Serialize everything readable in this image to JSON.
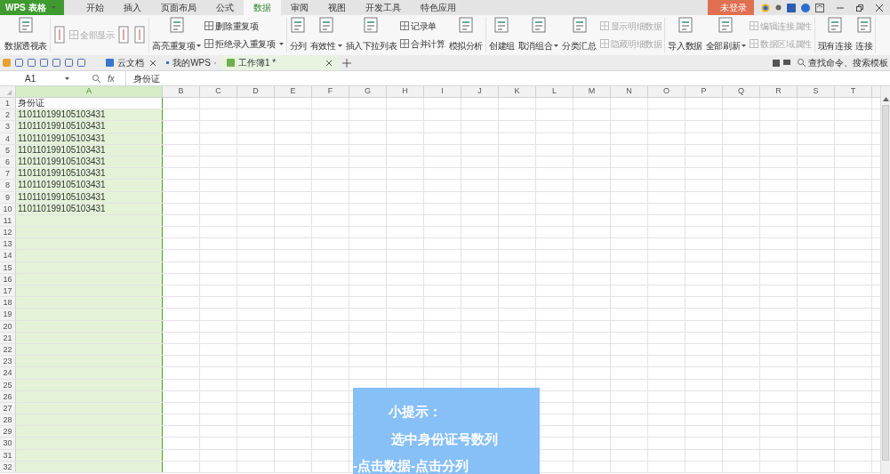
{
  "title_bar": {
    "app_button": "WPS 表格",
    "menu_tabs": [
      {
        "label": "开始",
        "selected": false
      },
      {
        "label": "插入",
        "selected": false
      },
      {
        "label": "页面布局",
        "selected": false
      },
      {
        "label": "公式",
        "selected": false
      },
      {
        "label": "数据",
        "selected": true
      },
      {
        "label": "审阅",
        "selected": false
      },
      {
        "label": "视图",
        "selected": false
      },
      {
        "label": "开发工具",
        "selected": false
      },
      {
        "label": "特色应用",
        "selected": false
      }
    ],
    "login": "未登录"
  },
  "ribbon": {
    "groups": [
      {
        "items": [
          {
            "kind": "large",
            "label": "数据透视表",
            "dropdown": false,
            "disabled": false
          }
        ]
      },
      {
        "items": [
          {
            "kind": "icon"
          },
          {
            "kind": "stack",
            "children": [
              {
                "label": "全部显示",
                "disabled": true,
                "dropdown": false
              }
            ]
          },
          {
            "kind": "icon"
          },
          {
            "kind": "icon"
          }
        ]
      },
      {
        "items": [
          {
            "kind": "large",
            "label": "高亮重复项",
            "dropdown": true,
            "disabled": false
          },
          {
            "kind": "stack",
            "children": [
              {
                "label": "删除重复项",
                "disabled": false,
                "dropdown": false
              },
              {
                "label": "拒绝录入重复项",
                "disabled": false,
                "dropdown": true
              }
            ]
          }
        ]
      },
      {
        "items": [
          {
            "kind": "large",
            "label": "分列",
            "dropdown": false,
            "disabled": false
          },
          {
            "kind": "large",
            "label": "有效性",
            "dropdown": true,
            "disabled": false
          },
          {
            "kind": "large",
            "label": "插入下拉列表",
            "dropdown": false,
            "disabled": false
          },
          {
            "kind": "stack",
            "children": [
              {
                "label": "记录单",
                "disabled": false,
                "dropdown": false
              },
              {
                "label": "合并计算",
                "disabled": false,
                "dropdown": false
              }
            ]
          },
          {
            "kind": "large",
            "label": "模拟分析",
            "dropdown": false,
            "disabled": false
          }
        ]
      },
      {
        "items": [
          {
            "kind": "large",
            "label": "创建组",
            "dropdown": false,
            "disabled": false
          },
          {
            "kind": "large",
            "label": "取消组合",
            "dropdown": true,
            "disabled": false
          },
          {
            "kind": "large",
            "label": "分类汇总",
            "dropdown": false,
            "disabled": false
          },
          {
            "kind": "stack",
            "children": [
              {
                "label": "显示明细数据",
                "disabled": true,
                "dropdown": false
              },
              {
                "label": "隐藏明细数据",
                "disabled": true,
                "dropdown": false
              }
            ]
          }
        ]
      },
      {
        "items": [
          {
            "kind": "large",
            "label": "导入数据",
            "dropdown": false,
            "disabled": false
          },
          {
            "kind": "large",
            "label": "全部刷新",
            "dropdown": true,
            "disabled": false
          },
          {
            "kind": "stack",
            "children": [
              {
                "label": "编辑连接属性",
                "disabled": true,
                "dropdown": false
              },
              {
                "label": "数据区域属性",
                "disabled": true,
                "dropdown": false
              }
            ]
          }
        ]
      },
      {
        "items": [
          {
            "kind": "large",
            "label": "现有连接",
            "dropdown": false,
            "disabled": false
          },
          {
            "kind": "large",
            "label": "连接",
            "dropdown": false,
            "disabled": false
          }
        ]
      }
    ]
  },
  "doc_tabs": [
    {
      "label": "云文档",
      "selected": false
    },
    {
      "label": "我的WPS",
      "selected": false
    },
    {
      "label": "工作簿1 *",
      "selected": true
    }
  ],
  "search": {
    "placeholder": "查找命令、搜索模板"
  },
  "formula_bar": {
    "cell_ref": "A1",
    "fx": "fx",
    "value": "身份证"
  },
  "sheet": {
    "columns": [
      {
        "label": "A",
        "selected": true
      },
      {
        "label": "B",
        "selected": false
      },
      {
        "label": "C",
        "selected": false
      },
      {
        "label": "D",
        "selected": false
      },
      {
        "label": "E",
        "selected": false
      },
      {
        "label": "F",
        "selected": false
      },
      {
        "label": "G",
        "selected": false
      },
      {
        "label": "H",
        "selected": false
      },
      {
        "label": "I",
        "selected": false
      },
      {
        "label": "J",
        "selected": false
      },
      {
        "label": "K",
        "selected": false
      },
      {
        "label": "L",
        "selected": false
      },
      {
        "label": "M",
        "selected": false
      },
      {
        "label": "N",
        "selected": false
      },
      {
        "label": "O",
        "selected": false
      },
      {
        "label": "P",
        "selected": false
      },
      {
        "label": "Q",
        "selected": false
      },
      {
        "label": "R",
        "selected": false
      },
      {
        "label": "S",
        "selected": false
      },
      {
        "label": "T",
        "selected": false
      }
    ],
    "rows": [
      {
        "number": "1",
        "a": "身份证"
      },
      {
        "number": "2",
        "a": "110110199105103431"
      },
      {
        "number": "3",
        "a": "110110199105103431"
      },
      {
        "number": "4",
        "a": "110110199105103431"
      },
      {
        "number": "5",
        "a": "110110199105103431"
      },
      {
        "number": "6",
        "a": "110110199105103431"
      },
      {
        "number": "7",
        "a": "110110199105103431"
      },
      {
        "number": "8",
        "a": "110110199105103431"
      },
      {
        "number": "9",
        "a": "110110199105103431"
      },
      {
        "number": "10",
        "a": "110110199105103431"
      },
      {
        "number": "11"
      },
      {
        "number": "12"
      },
      {
        "number": "13"
      },
      {
        "number": "14"
      },
      {
        "number": "15"
      },
      {
        "number": "16"
      },
      {
        "number": "17"
      },
      {
        "number": "18"
      },
      {
        "number": "19"
      },
      {
        "number": "20"
      },
      {
        "number": "21"
      },
      {
        "number": "22"
      },
      {
        "number": "23"
      },
      {
        "number": "24"
      },
      {
        "number": "25"
      },
      {
        "number": "26"
      },
      {
        "number": "27"
      },
      {
        "number": "28"
      },
      {
        "number": "29"
      },
      {
        "number": "30"
      },
      {
        "number": "31"
      },
      {
        "number": "32"
      }
    ]
  },
  "hint": {
    "title": "小提示：",
    "lines": [
      "选中身份证号数列",
      "-点击数据-点击分列"
    ]
  }
}
